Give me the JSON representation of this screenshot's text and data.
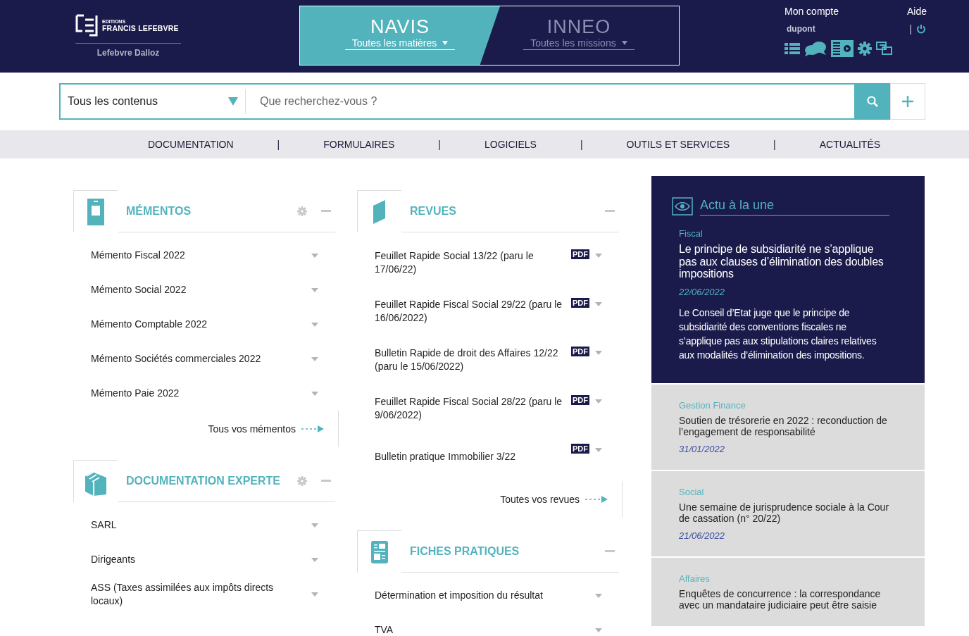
{
  "header": {
    "logo": {
      "edition": "EDITIONS",
      "brand": "FRANCIS LEFEBVRE",
      "group": "Lefebvre Dalloz"
    },
    "products": [
      {
        "name": "NAVIS",
        "scope": "Toutes les matières",
        "selected": true
      },
      {
        "name": "INNEO",
        "scope": "Toutes les missions",
        "selected": false
      }
    ],
    "account": {
      "label": "Mon compte",
      "help": "Aide",
      "user": "dupont",
      "separator": "|"
    }
  },
  "search": {
    "scope": "Tous les contenus",
    "placeholder": "Que recherchez-vous ?"
  },
  "nav": {
    "separator": "|",
    "items": [
      "DOCUMENTATION",
      "FORMULAIRES",
      "LOGICIELS",
      "OUTILS ET SERVICES",
      "ACTUALITÉS"
    ]
  },
  "columns": [
    [
      {
        "kind": "memento",
        "title": "MÉMENTOS",
        "settings": true,
        "items": [
          {
            "label": "Mémento Fiscal 2022"
          },
          {
            "label": "Mémento Social 2022"
          },
          {
            "label": "Mémento Comptable 2022"
          },
          {
            "label": "Mémento Sociétés commerciales 2022"
          },
          {
            "label": "Mémento Paie 2022"
          }
        ],
        "more": "Tous vos mémentos"
      },
      {
        "kind": "books",
        "title": "DOCUMENTATION EXPERTE",
        "settings": true,
        "items": [
          {
            "label": "SARL"
          },
          {
            "label": "Dirigeants"
          },
          {
            "label": "ASS (Taxes assimilées aux impôts directs locaux)"
          }
        ]
      }
    ],
    [
      {
        "kind": "journal",
        "title": "REVUES",
        "settings": false,
        "items": [
          {
            "label": "Feuillet Rapide Social 13/22 (paru le 17/06/22)",
            "pdf": "PDF"
          },
          {
            "label": "Feuillet Rapide Fiscal Social 29/22 (paru le 16/06/2022)",
            "pdf": "PDF"
          },
          {
            "label": "Bulletin Rapide de droit des Affaires 12/22 (paru le 15/06/2022)",
            "pdf": "PDF"
          },
          {
            "label": "Feuillet Rapide Fiscal Social 28/22 (paru le 9/06/2022)",
            "pdf": "PDF"
          },
          {
            "label": "Bulletin pratique Immobilier 3/22",
            "pdf": "PDF"
          }
        ],
        "more": "Toutes vos revues"
      },
      {
        "kind": "sheet",
        "title": "FICHES PRATIQUES",
        "settings": false,
        "items": [
          {
            "label": "Détermination et imposition du résultat"
          },
          {
            "label": "TVA"
          }
        ]
      }
    ]
  ],
  "news": {
    "title": "Actu à la une",
    "items": [
      {
        "featured": true,
        "category": "Fiscal",
        "headline": "Le principe de subsidiarité ne s’applique pas aux clauses d’élimination des doubles impositions",
        "date": "22/06/2022",
        "summary": "Le Conseil d’Etat juge que le principe de subsidiarité des conventions fiscales ne s’applique pas aux stipulations claires relatives aux modalités d’élimination des impositions."
      },
      {
        "featured": false,
        "category": "Gestion Finance",
        "headline": "Soutien de trésorerie en 2022 : reconduction de l’engagement de responsabilité",
        "date": "31/01/2022"
      },
      {
        "featured": false,
        "category": "Social",
        "headline": "Une semaine de jurisprudence sociale à la Cour de cassation (n° 20/22)",
        "date": "21/06/2022"
      },
      {
        "featured": false,
        "category": "Affaires",
        "headline": "Enquêtes de concurrence : la correspondance avec un mandataire judiciaire peut être saisie"
      }
    ]
  }
}
